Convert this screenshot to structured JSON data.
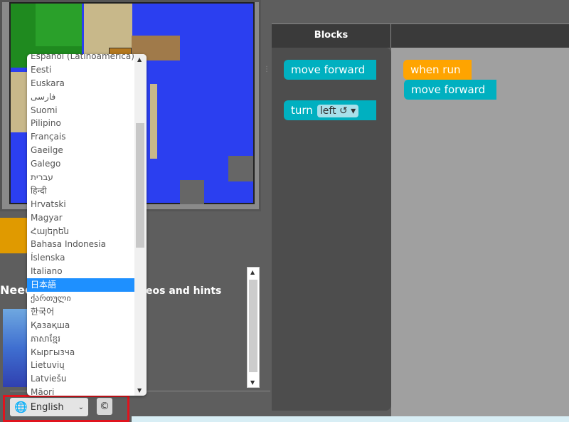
{
  "language_menu": {
    "options": [
      "Español (Latinoamérica)",
      "Eesti",
      "Euskara",
      "فارسی",
      "Suomi",
      "Pilipino",
      "Français",
      "Gaeilge",
      "Galego",
      "עברית",
      "हिन्दी",
      "Hrvatski",
      "Magyar",
      "Հայերեն",
      "Bahasa Indonesia",
      "Íslenska",
      "Italiano",
      "日本語",
      "ქართული",
      "한국어",
      "Қазақша",
      "ភាសាខ្មែរ",
      "Кыргызча",
      "Lietuvių",
      "Latviešu",
      "Māori"
    ],
    "highlighted": "日本語"
  },
  "footer": {
    "language_label": "English",
    "copyright_label": "©"
  },
  "help": {
    "title_partial": "Need",
    "subtitle_partial": "eos and hints"
  },
  "workspace": {
    "tab_label": "Blocks",
    "toolbox_blocks": [
      {
        "label": "move forward"
      },
      {
        "label": "turn",
        "dropdown": "left ↺"
      }
    ],
    "program_blocks": [
      {
        "label": "when run",
        "color": "#ffa400"
      },
      {
        "label": "move forward",
        "color": "#00b0c0"
      }
    ]
  },
  "colors": {
    "accent_teal": "#00b0c0",
    "event_orange": "#ffa400",
    "highlight": "#e0141e",
    "selection": "#1e90ff"
  }
}
